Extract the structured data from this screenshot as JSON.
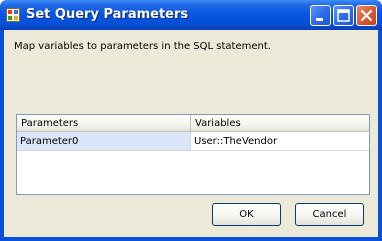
{
  "window": {
    "title": "Set Query Parameters",
    "icon": "app-window-icon",
    "controls": [
      "minimize-icon",
      "maximize-icon",
      "close-icon"
    ]
  },
  "description": "Map variables to parameters in the SQL statement.",
  "grid": {
    "headers": [
      "Parameters",
      "Variables"
    ],
    "rows": [
      {
        "parameter": "Parameter0",
        "variable": "User::TheVendor"
      }
    ]
  },
  "buttons": {
    "ok": "OK",
    "cancel": "Cancel"
  },
  "colors": {
    "titlebar": "#0755df",
    "client": "#ece9d8",
    "selected_cell": "#dce6fa",
    "grid_border": "#7f9db9"
  }
}
